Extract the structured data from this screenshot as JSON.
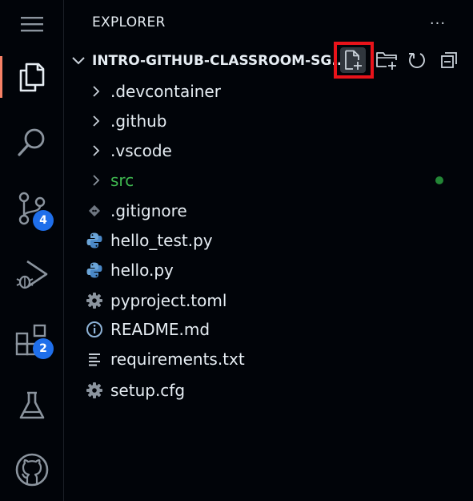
{
  "explorer": {
    "title": "EXPLORER",
    "more_label": "···"
  },
  "project": {
    "name": "INTRO-GITHUB-CLASSROOM-SG..."
  },
  "tree": [
    {
      "label": ".devcontainer",
      "type": "folder",
      "icon": "chevron-right-icon"
    },
    {
      "label": ".github",
      "type": "folder",
      "icon": "chevron-right-icon"
    },
    {
      "label": ".vscode",
      "type": "folder",
      "icon": "chevron-right-icon"
    },
    {
      "label": "src",
      "type": "folder",
      "icon": "chevron-right-icon",
      "modified": true
    },
    {
      "label": ".gitignore",
      "type": "file",
      "icon": "git-diamond-icon"
    },
    {
      "label": "hello_test.py",
      "type": "file",
      "icon": "python-icon"
    },
    {
      "label": "hello.py",
      "type": "file",
      "icon": "python-icon"
    },
    {
      "label": "pyproject.toml",
      "type": "file",
      "icon": "gear-icon"
    },
    {
      "label": "README.md",
      "type": "file",
      "icon": "info-icon"
    },
    {
      "label": "requirements.txt",
      "type": "file",
      "icon": "lines-icon"
    },
    {
      "label": "setup.cfg",
      "type": "file",
      "icon": "gear-icon"
    }
  ],
  "activity_bar": {
    "source_control_badge": "4",
    "extensions_badge": "2"
  },
  "colors": {
    "background": "#010409",
    "accent_active": "#f78166",
    "badge": "#1f6feb",
    "modified": "#3fb950",
    "highlight": "#e8131a"
  }
}
